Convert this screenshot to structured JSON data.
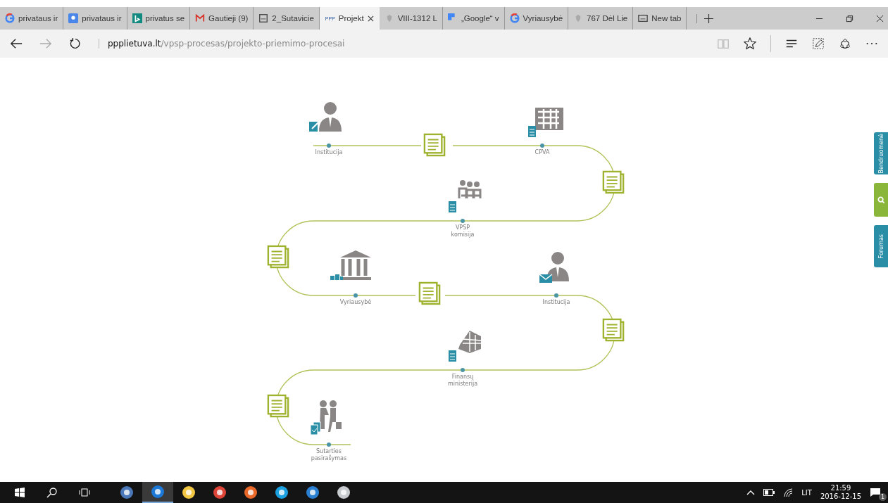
{
  "tabs": [
    {
      "title": "privataus ir",
      "selected": false
    },
    {
      "title": "privataus ir",
      "selected": false
    },
    {
      "title": "privatus se",
      "selected": false
    },
    {
      "title": "Gautieji (9)",
      "selected": false
    },
    {
      "title": "2_Sutavicie",
      "selected": false
    },
    {
      "favicon_text": "PPP",
      "title": "Projekt",
      "selected": true
    },
    {
      "title": "VIII-1312 L",
      "selected": false
    },
    {
      "title": "„Google“ v",
      "selected": false
    },
    {
      "title": "Vyriausybė",
      "selected": false
    },
    {
      "title": "767 Dėl Lie",
      "selected": false
    },
    {
      "title": "New tab",
      "selected": false
    }
  ],
  "address": {
    "domain": "ppplietuva.lt",
    "path": "/vpsp-procesas/projekto-priemimo-procesai"
  },
  "diagram": {
    "nodes": [
      {
        "label": "Institucija"
      },
      {
        "label": "CPVA"
      },
      {
        "label": "VPSP komisija"
      },
      {
        "label": "Vyriausybė"
      },
      {
        "label": "Institucija"
      },
      {
        "label": "Finansų ministerija"
      },
      {
        "label": "Sutarties pasirašymas"
      }
    ]
  },
  "side_tabs": [
    {
      "kind": "text",
      "label": "Bendruomenė"
    },
    {
      "kind": "search"
    },
    {
      "kind": "text",
      "label": "Forumas"
    }
  ],
  "taskbar": {
    "apps": [
      {
        "active": false
      },
      {
        "active": true
      },
      {
        "active": false
      },
      {
        "active": false
      },
      {
        "active": false
      },
      {
        "active": false
      },
      {
        "active": false
      },
      {
        "active": false
      }
    ],
    "language": "LIT",
    "time": "21:59",
    "date": "2016-12-15",
    "notifications": "1"
  }
}
